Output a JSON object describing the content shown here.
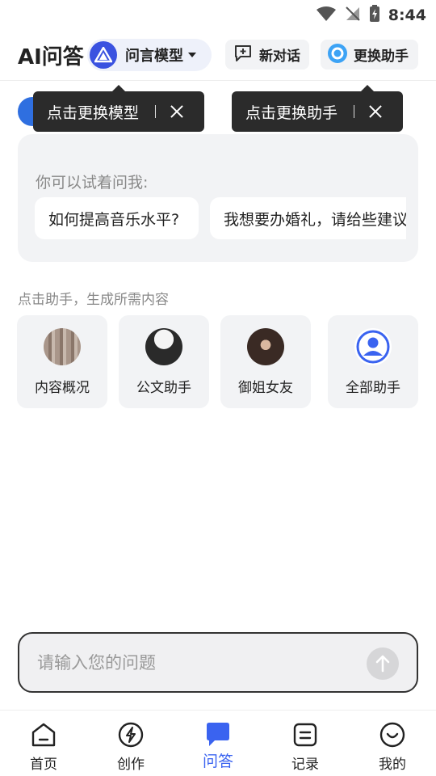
{
  "status_bar": {
    "time": "8:44",
    "icons": [
      "wifi-icon",
      "no-signal-icon",
      "battery-charging-icon"
    ]
  },
  "header": {
    "title": "AI问答",
    "model_selector": {
      "label": "问言模型",
      "icon": "model-logo-icon"
    },
    "new_chat": {
      "label": "新对话",
      "icon": "chat-plus-icon"
    },
    "switch_assistant": {
      "label": "更换助手",
      "icon": "assistant-logo-icon"
    }
  },
  "tooltips": {
    "model": "点击更换模型",
    "assistant": "点击更换助手"
  },
  "suggestions": {
    "hint": "你可以试着问我:",
    "items": [
      "如何提高音乐水平?",
      "我想要办婚礼，请给些建议"
    ]
  },
  "assistants": {
    "section_title": "点击助手，生成所需内容",
    "items": [
      {
        "name": "内容概况",
        "icon": "content-avatar"
      },
      {
        "name": "公文助手",
        "icon": "document-avatar"
      },
      {
        "name": "御姐女友",
        "icon": "girlfriend-avatar"
      },
      {
        "name": "全部助手",
        "icon": "user-circle-icon"
      }
    ]
  },
  "input": {
    "placeholder": "请输入您的问题",
    "value": ""
  },
  "bottom_nav": {
    "items": [
      {
        "label": "首页",
        "icon": "home-icon"
      },
      {
        "label": "创作",
        "icon": "lightning-icon"
      },
      {
        "label": "问答",
        "icon": "chat-bubble-icon"
      },
      {
        "label": "记录",
        "icon": "record-icon"
      },
      {
        "label": "我的",
        "icon": "smile-icon"
      }
    ],
    "active": "问答"
  },
  "colors": {
    "accent": "#3a63f0",
    "tooltip_bg": "#2b2b2b",
    "card_bg": "#f2f3f5"
  }
}
